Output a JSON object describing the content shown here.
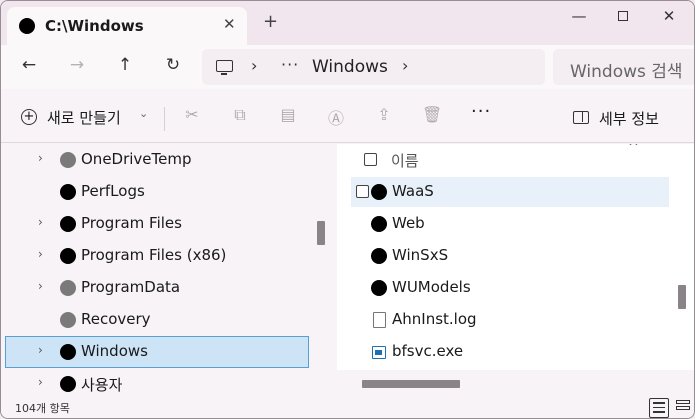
{
  "tab": {
    "title": "C:\\Windows",
    "close": "✕",
    "new_tab": "+"
  },
  "window_controls": {
    "minimize": "—",
    "close": "✕"
  },
  "nav": {
    "back": "←",
    "forward": "→",
    "up": "↑",
    "refresh": "↻"
  },
  "address": {
    "chevron1": "›",
    "more": "···",
    "folder": "Windows",
    "chevron2": "›"
  },
  "search": {
    "placeholder": "Windows 검색"
  },
  "command_bar": {
    "new_label": "새로 만들기",
    "new_chevron": "⌄",
    "cut": "✂",
    "copy": "⧉",
    "paste": "▤",
    "rename": "Ⓐ",
    "share": "⇪",
    "delete": "🗑",
    "more": "···",
    "details_label": "세부 정보"
  },
  "tree": {
    "chevron": "›",
    "items": [
      {
        "label": "OneDriveTemp",
        "icon": "grey-circle",
        "expandable": true
      },
      {
        "label": "PerfLogs",
        "icon": "black-circle",
        "expandable": false
      },
      {
        "label": "Program Files",
        "icon": "black-circle",
        "expandable": true
      },
      {
        "label": "Program Files (x86)",
        "icon": "black-circle",
        "expandable": true
      },
      {
        "label": "ProgramData",
        "icon": "grey-circle",
        "expandable": true
      },
      {
        "label": "Recovery",
        "icon": "grey-circle",
        "expandable": false
      },
      {
        "label": "Windows",
        "icon": "black-circle",
        "expandable": true,
        "selected": true
      },
      {
        "label": "사용자",
        "icon": "black-circle",
        "expandable": true
      }
    ]
  },
  "files": {
    "header_name": "이름",
    "sort_arrow": "^",
    "items": [
      {
        "label": "WaaS",
        "icon": "folder-circle"
      },
      {
        "label": "Web",
        "icon": "folder-circle"
      },
      {
        "label": "WinSxS",
        "icon": "folder-circle"
      },
      {
        "label": "WUModels",
        "icon": "folder-circle"
      },
      {
        "label": "AhnInst.log",
        "icon": "document"
      },
      {
        "label": "bfsvc.exe",
        "icon": "executable"
      }
    ]
  },
  "status": {
    "item_count": "104개 항목"
  },
  "colors": {
    "selected_bg": "#cde4f7",
    "selected_border": "#5a9fd4",
    "titlebar": "#f1e6ed"
  }
}
